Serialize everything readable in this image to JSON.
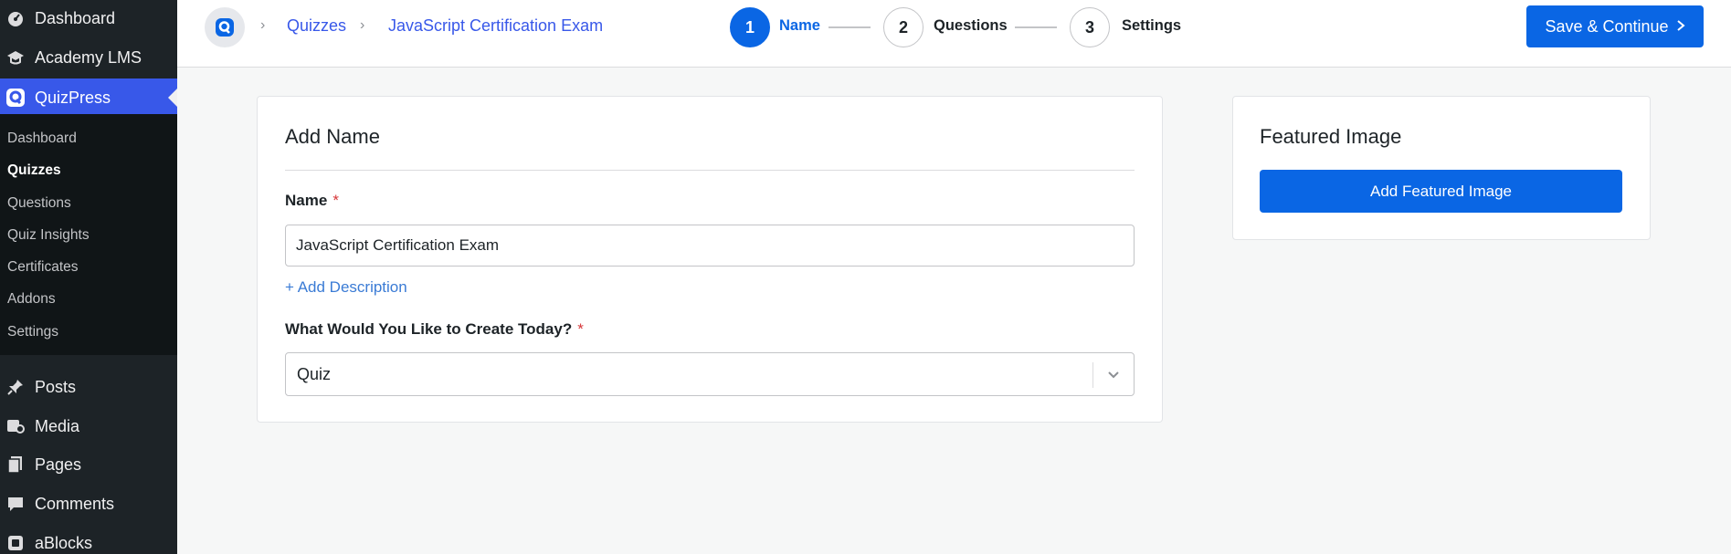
{
  "sidebar": {
    "top_items": [
      {
        "label": "Dashboard",
        "icon": "dashboard-icon"
      },
      {
        "label": "Academy LMS",
        "icon": "academy-icon"
      },
      {
        "label": "QuizPress",
        "icon": "quizpress-icon"
      }
    ],
    "submenu": [
      "Dashboard",
      "Quizzes",
      "Questions",
      "Quiz Insights",
      "Certificates",
      "Addons",
      "Settings"
    ],
    "bottom_items": [
      {
        "label": "Posts",
        "icon": "pin-icon"
      },
      {
        "label": "Media",
        "icon": "media-icon"
      },
      {
        "label": "Pages",
        "icon": "pages-icon"
      },
      {
        "label": "Comments",
        "icon": "comment-icon"
      },
      {
        "label": "aBlocks",
        "icon": "ablocks-icon"
      }
    ]
  },
  "header": {
    "breadcrumb": [
      "Quizzes",
      "JavaScript Certification Exam"
    ],
    "steps": [
      {
        "number": "1",
        "label": "Name"
      },
      {
        "number": "2",
        "label": "Questions"
      },
      {
        "number": "3",
        "label": "Settings"
      }
    ],
    "save_label": "Save & Continue"
  },
  "form": {
    "title": "Add Name",
    "name_label": "Name",
    "required_mark": "*",
    "name_value": "JavaScript Certification Exam",
    "add_description": "+ Add Description",
    "create_label": "What Would You Like to Create Today?",
    "create_value": "Quiz"
  },
  "featured": {
    "title": "Featured Image",
    "button_label": "Add Featured Image"
  },
  "colors": {
    "primary": "#0a66e4",
    "sidebar_bg": "#1d2327",
    "active_menu": "#3858e9"
  }
}
